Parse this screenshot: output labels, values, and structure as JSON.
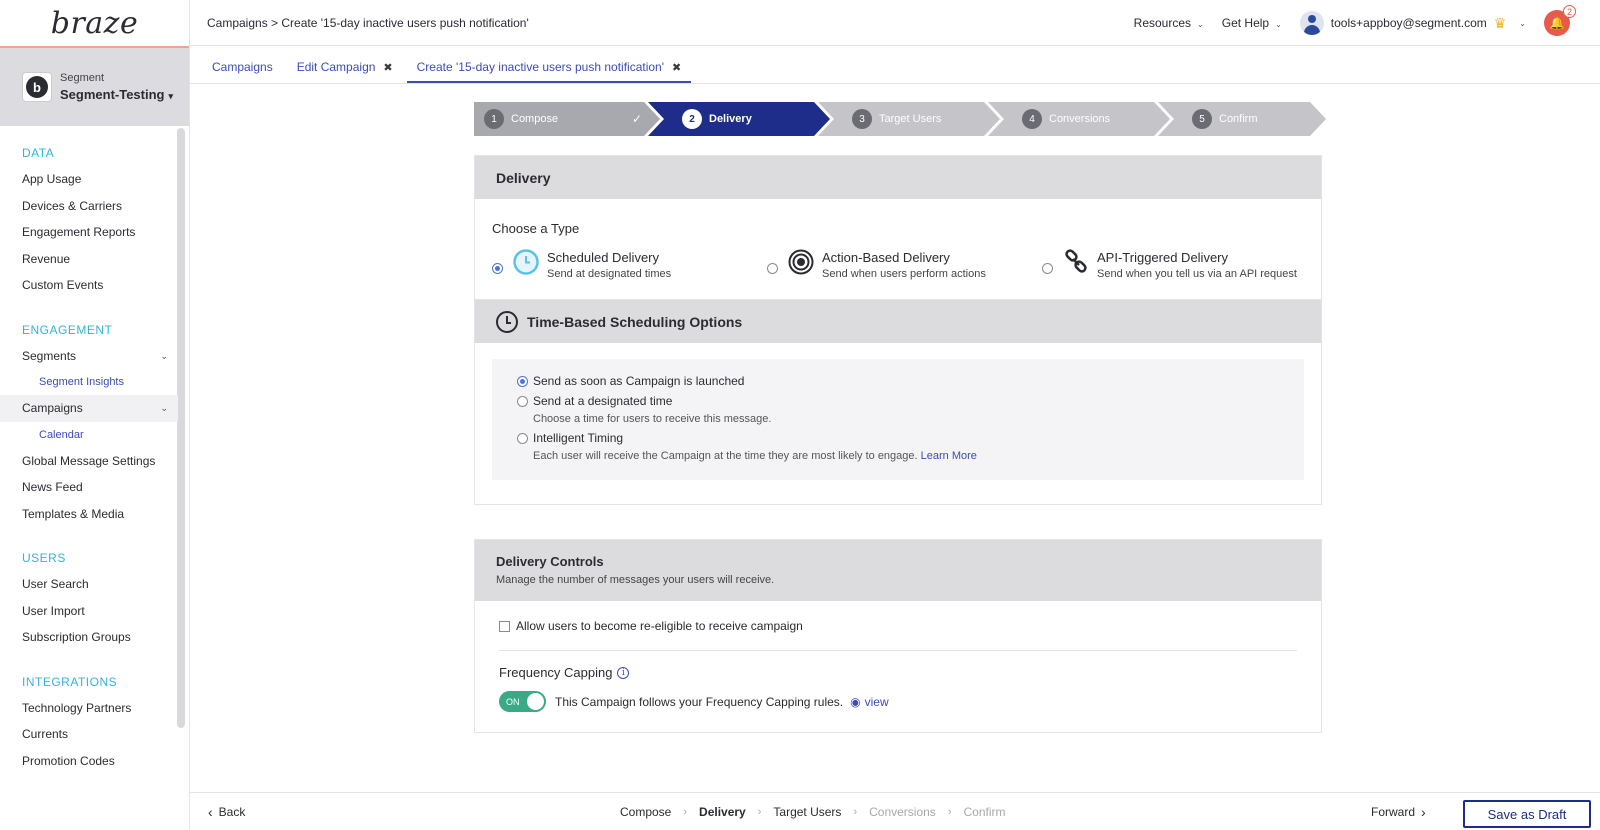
{
  "app": {
    "logo": "braze"
  },
  "workspace": {
    "label": "Segment",
    "name": "Segment-Testing",
    "avatar_letter": "b"
  },
  "sidebar": {
    "sections": [
      {
        "title": "DATA",
        "items": [
          "App Usage",
          "Devices & Carriers",
          "Engagement Reports",
          "Revenue",
          "Custom Events"
        ]
      },
      {
        "title": "ENGAGEMENT",
        "items": [
          "Segments",
          "Segment Insights",
          "Campaigns",
          "Calendar",
          "Global Message Settings",
          "News Feed",
          "Templates & Media"
        ]
      },
      {
        "title": "USERS",
        "items": [
          "User Search",
          "User Import",
          "Subscription Groups"
        ]
      },
      {
        "title": "INTEGRATIONS",
        "items": [
          "Technology Partners",
          "Currents",
          "Promotion Codes"
        ]
      }
    ]
  },
  "header": {
    "breadcrumb": "Campaigns > Create '15-day inactive users push notification'",
    "resources": "Resources",
    "help": "Get Help",
    "user_email": "tools+appboy@segment.com",
    "notification_count": "2"
  },
  "tabs": [
    {
      "label": "Campaigns"
    },
    {
      "label": "Edit Campaign"
    },
    {
      "label": "Create '15-day inactive users push notification'"
    }
  ],
  "stepper": [
    {
      "num": "1",
      "label": "Compose",
      "state": "done"
    },
    {
      "num": "2",
      "label": "Delivery",
      "state": "current"
    },
    {
      "num": "3",
      "label": "Target Users",
      "state": "pending"
    },
    {
      "num": "4",
      "label": "Conversions",
      "state": "pending"
    },
    {
      "num": "5",
      "label": "Confirm",
      "state": "pending"
    }
  ],
  "delivery": {
    "title": "Delivery",
    "choose_label": "Choose a Type",
    "types": [
      {
        "title": "Scheduled Delivery",
        "desc": "Send at designated times",
        "selected": true
      },
      {
        "title": "Action-Based Delivery",
        "desc": "Send when users perform actions",
        "selected": false
      },
      {
        "title": "API-Triggered Delivery",
        "desc": "Send when you tell us via an API request",
        "selected": false
      }
    ]
  },
  "scheduling": {
    "title": "Time-Based Scheduling Options",
    "options": [
      {
        "title": "Send as soon as Campaign is launched",
        "desc": "",
        "selected": true
      },
      {
        "title": "Send at a designated time",
        "desc": "Choose a time for users to receive this message.",
        "selected": false
      },
      {
        "title": "Intelligent Timing",
        "desc": "Each user will receive the Campaign at the time they are most likely to engage.",
        "selected": false
      }
    ],
    "learn_more": "Learn More"
  },
  "controls": {
    "title": "Delivery Controls",
    "subtitle": "Manage the number of messages your users will receive.",
    "reeligible_label": "Allow users to become re-eligible to receive campaign",
    "freq_title": "Frequency Capping",
    "toggle_label": "ON",
    "freq_text": "This Campaign follows your Frequency Capping rules.",
    "view_label": "view"
  },
  "footer": {
    "back": "Back",
    "forward": "Forward",
    "save": "Save as Draft",
    "steps": [
      "Compose",
      "Delivery",
      "Target Users",
      "Conversions",
      "Confirm"
    ]
  },
  "colors": {
    "accent": "#1e2d8a",
    "section": "#33b3dc",
    "link": "#3d4bb8",
    "toggle_on": "#3aaa86",
    "step_done": "#a8a8af",
    "step_pending": "#c4c4c9"
  }
}
